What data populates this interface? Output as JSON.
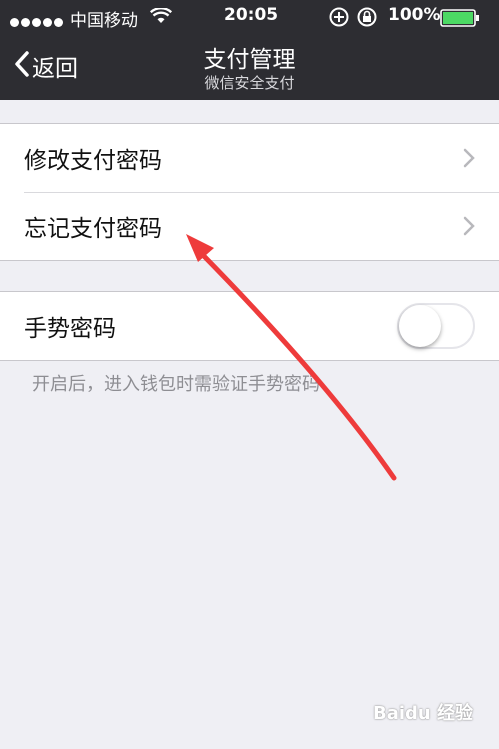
{
  "status_bar": {
    "carrier": "中国移动",
    "time": "20:05",
    "battery": "100%",
    "battery_color": "#4cd964"
  },
  "nav": {
    "back_label": "返回",
    "title": "支付管理",
    "subtitle": "微信安全支付"
  },
  "section1": {
    "items": [
      {
        "label": "修改支付密码"
      },
      {
        "label": "忘记支付密码"
      }
    ]
  },
  "section2": {
    "gesture_label": "手势密码",
    "gesture_enabled": false,
    "note": "开启后，进入钱包时需验证手势密码"
  },
  "annotation": {
    "arrow_color": "#ee3b3b"
  },
  "watermark": "Baidu 经验"
}
